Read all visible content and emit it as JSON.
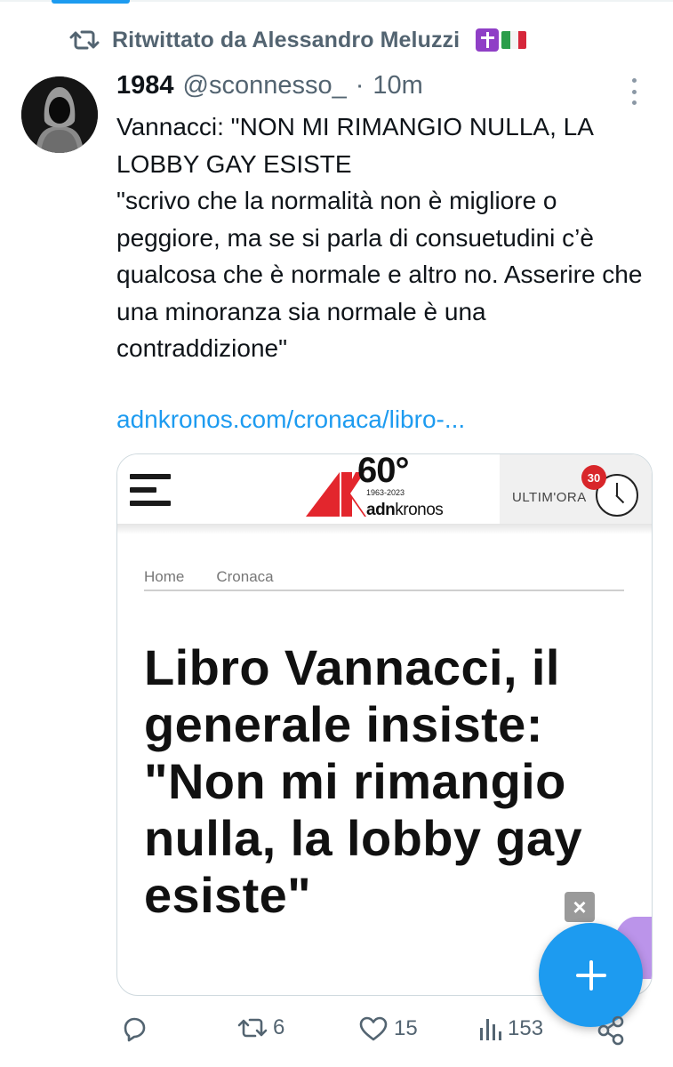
{
  "retweet": {
    "label": "Ritwittato da Alessandro Meluzzi"
  },
  "tweet": {
    "display_name": "1984",
    "handle": "@sconnesso_",
    "separator": "·",
    "time": "10m",
    "text": "Vannacci: \"NON MI RIMANGIO NULLA, LA LOBBY GAY ESISTE\n\"scrivo che la normalità non è migliore o peggiore, ma se si parla di consuetudini c’è qualcosa che è normale e altro no. Asserire che una minoranza sia normale è una contraddizione\"",
    "link": "adnkronos.com/cronaca/libro-..."
  },
  "card": {
    "logo_number": "60°",
    "logo_years": "1963-2023",
    "logo_brand_bold": "adn",
    "logo_brand_rest": "kronos",
    "ultimora_label": "ULTIM'ORA",
    "ultimora_badge": "30",
    "breadcrumb": [
      "Home",
      "Cronaca"
    ],
    "headline": "Libro Vannacci, il generale insiste: \"Non mi rimangio nulla, la lobby gay esiste\"",
    "close_label": "×"
  },
  "actions": {
    "replies": "",
    "retweets": "6",
    "likes": "15",
    "views": "153"
  },
  "colors": {
    "accent": "#1d9bf0",
    "secondary_text": "#536471",
    "logo_red": "#e3262d"
  },
  "icons": [
    "retweet-icon",
    "avatar",
    "more-icon",
    "hamburger-icon",
    "clock-icon",
    "close-icon",
    "compose-plus-icon",
    "reply-icon",
    "like-icon",
    "views-icon",
    "share-icon"
  ]
}
